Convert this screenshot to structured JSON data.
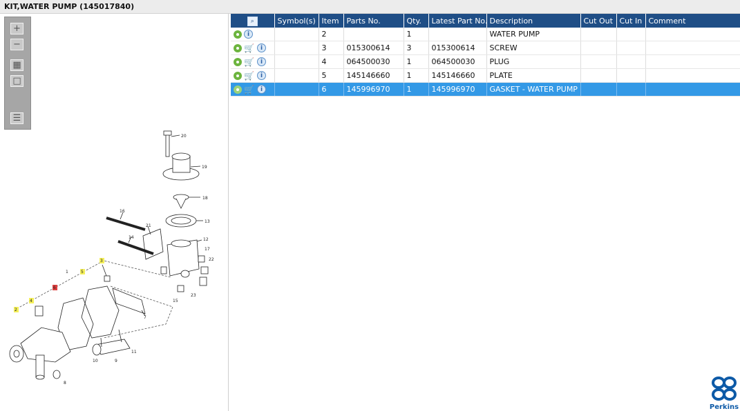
{
  "window": {
    "title": "KIT,WATER PUMP (145017840)"
  },
  "toolbox": {
    "buttons": [
      {
        "icon": "zoom-in-icon",
        "glyph": "+"
      },
      {
        "icon": "zoom-out-icon",
        "glyph": "−"
      },
      {
        "icon": "fit-all-icon",
        "glyph": "▦"
      },
      {
        "icon": "actual-size-icon",
        "glyph": "□"
      },
      {
        "icon": "list-export-icon",
        "glyph": "☰"
      }
    ]
  },
  "diagram": {
    "callouts": [
      "20",
      "19",
      "18",
      "13",
      "12",
      "16",
      "21",
      "14",
      "17",
      "22",
      "3",
      "1",
      "5",
      "23",
      "15",
      "6",
      "4",
      "7",
      "2",
      "11",
      "10",
      "9",
      "8"
    ]
  },
  "table": {
    "headers": [
      "",
      "Symbol(s)",
      "Item",
      "Parts No.",
      "Qty.",
      "Latest Part No.",
      "Description",
      "Cut Out",
      "Cut In",
      "Comment"
    ],
    "rows": [
      {
        "item": "2",
        "parts_no": "",
        "qty": "1",
        "latest": "",
        "description": "WATER PUMP",
        "cart": false,
        "selected": false
      },
      {
        "item": "3",
        "parts_no": "015300614",
        "qty": "3",
        "latest": "015300614",
        "description": "SCREW",
        "cart": true,
        "selected": false
      },
      {
        "item": "4",
        "parts_no": "064500030",
        "qty": "1",
        "latest": "064500030",
        "description": "PLUG",
        "cart": true,
        "selected": false
      },
      {
        "item": "5",
        "parts_no": "145146660",
        "qty": "1",
        "latest": "145146660",
        "description": "PLATE",
        "cart": true,
        "selected": false
      },
      {
        "item": "6",
        "parts_no": "145996970",
        "qty": "1",
        "latest": "145996970",
        "description": "GASKET - WATER PUMP",
        "cart": true,
        "selected": true
      }
    ]
  },
  "brand": {
    "name": "Perkins",
    "color": "#0d5aa7"
  },
  "colors": {
    "header": "#1f4e86",
    "selected": "#3399e6",
    "highlight": "#f5f05a",
    "highlight_red": "#e04040"
  }
}
